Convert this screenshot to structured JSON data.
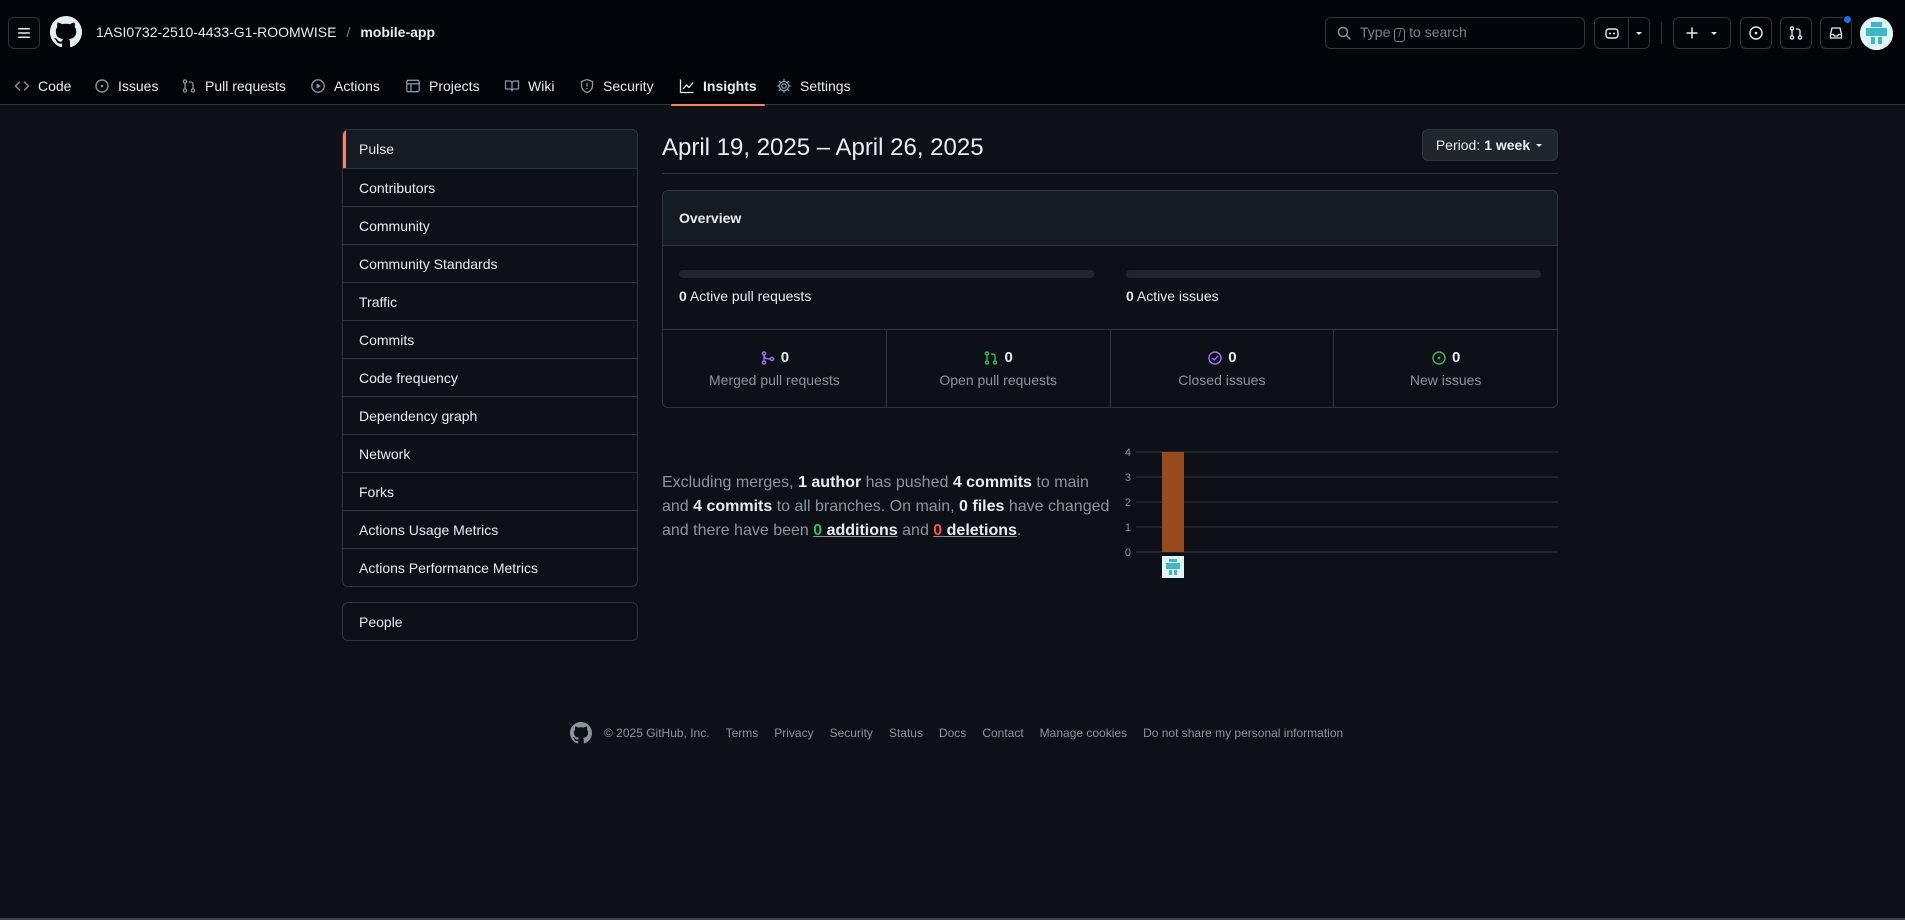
{
  "header": {
    "owner": "1ASI0732-2510-4433-G1-ROOMWISE",
    "separator": "/",
    "repo": "mobile-app",
    "search_prefix": "Type",
    "search_key": "/",
    "search_suffix": "to search"
  },
  "nav": {
    "tabs": [
      {
        "label": "Code",
        "icon": "code-icon"
      },
      {
        "label": "Issues",
        "icon": "issue-icon"
      },
      {
        "label": "Pull requests",
        "icon": "pull-request-icon"
      },
      {
        "label": "Actions",
        "icon": "play-icon"
      },
      {
        "label": "Projects",
        "icon": "table-icon"
      },
      {
        "label": "Wiki",
        "icon": "book-icon"
      },
      {
        "label": "Security",
        "icon": "shield-icon"
      },
      {
        "label": "Insights",
        "icon": "graph-icon",
        "selected": true
      },
      {
        "label": "Settings",
        "icon": "gear-icon"
      }
    ]
  },
  "sidebar": {
    "items": [
      {
        "label": "Pulse",
        "selected": true
      },
      {
        "label": "Contributors"
      },
      {
        "label": "Community"
      },
      {
        "label": "Community Standards"
      },
      {
        "label": "Traffic"
      },
      {
        "label": "Commits"
      },
      {
        "label": "Code frequency"
      },
      {
        "label": "Dependency graph"
      },
      {
        "label": "Network"
      },
      {
        "label": "Forks"
      },
      {
        "label": "Actions Usage Metrics"
      },
      {
        "label": "Actions Performance Metrics"
      }
    ],
    "people_label": "People"
  },
  "main": {
    "title": "April 19, 2025 – April 26, 2025",
    "period_label": "Period:",
    "period_value": "1 week",
    "overview": {
      "heading": "Overview",
      "active_prs_count": "0",
      "active_prs_label": "Active pull requests",
      "active_issues_count": "0",
      "active_issues_label": "Active issues",
      "stats": [
        {
          "count": "0",
          "label": "Merged pull requests",
          "icon": "merge-icon",
          "color": "#a371f7"
        },
        {
          "count": "0",
          "label": "Open pull requests",
          "icon": "pull-request-icon",
          "color": "#3fb950"
        },
        {
          "count": "0",
          "label": "Closed issues",
          "icon": "check-circle-icon",
          "color": "#a371f7"
        },
        {
          "count": "0",
          "label": "New issues",
          "icon": "issue-open-icon",
          "color": "#3fb950"
        }
      ]
    },
    "summary": {
      "t1": "Excluding merges, ",
      "authors": "1 author",
      "t2": " has pushed ",
      "commits_main": "4 commits",
      "t3": " to main and ",
      "commits_all": "4 commits",
      "t4": " to all branches. On main, ",
      "files": "0 files",
      "t5": " have changed and there have been ",
      "additions_num": "0",
      "additions_word": " additions",
      "t6": " and ",
      "deletions_num": "0",
      "deletions_word": " deletions",
      "t7": "."
    }
  },
  "chart_data": {
    "type": "bar",
    "categories": [
      "author"
    ],
    "values": [
      4
    ],
    "yticks": [
      0,
      1,
      2,
      3,
      4
    ],
    "ylim": [
      0,
      4
    ],
    "bar_color": "#9a4a1f",
    "grid": true
  },
  "footer": {
    "copyright": "© 2025 GitHub, Inc.",
    "links": [
      "Terms",
      "Privacy",
      "Security",
      "Status",
      "Docs",
      "Contact",
      "Manage cookies",
      "Do not share my personal information"
    ]
  },
  "colors": {
    "accent": "#f78166",
    "background": "#0d1117",
    "border": "#30363d"
  }
}
